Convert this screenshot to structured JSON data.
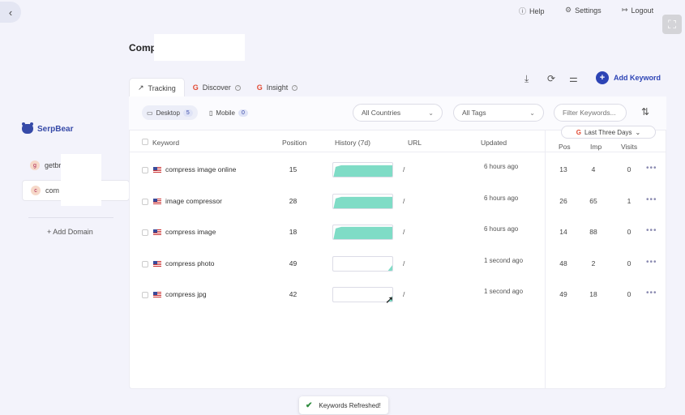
{
  "topnav": {
    "help": "Help",
    "settings": "Settings",
    "logout": "Logout"
  },
  "brand": {
    "name": "SerpBear"
  },
  "sidebar": {
    "domains": [
      {
        "avatar": "g",
        "label": "getbr"
      },
      {
        "avatar": "c",
        "label": "com"
      }
    ],
    "add_domain": "+ Add Domain"
  },
  "page_title": "Comp",
  "tabs": [
    {
      "label": "Tracking",
      "icon": "trend-icon"
    },
    {
      "label": "Discover",
      "icon": "google-icon"
    },
    {
      "label": "Insight",
      "icon": "google-icon"
    }
  ],
  "toolbar": {
    "add_keyword": "Add Keyword"
  },
  "filters": {
    "desktop": "Desktop",
    "desktop_count": "5",
    "mobile": "Mobile",
    "mobile_count": "0",
    "countries": "All Countries",
    "tags": "All Tags",
    "search_placeholder": "Filter Keywords..."
  },
  "table": {
    "headers": {
      "keyword": "Keyword",
      "position": "Position",
      "history": "History (7d)",
      "url": "URL",
      "updated": "Updated"
    },
    "gsc": {
      "range": "Last Three Days",
      "pos": "Pos",
      "imp": "Imp",
      "visits": "Visits"
    },
    "rows": [
      {
        "keyword": "compress image online",
        "position": "15",
        "url": "/",
        "updated": "6 hours ago",
        "pos": "13",
        "imp": "4",
        "visits": "0",
        "history_fill": 0.85
      },
      {
        "keyword": "image compressor",
        "position": "28",
        "url": "/",
        "updated": "6 hours ago",
        "pos": "26",
        "imp": "65",
        "visits": "1",
        "history_fill": 0.85
      },
      {
        "keyword": "compress image",
        "position": "18",
        "url": "/",
        "updated": "6 hours ago",
        "pos": "14",
        "imp": "88",
        "visits": "0",
        "history_fill": 0.9
      },
      {
        "keyword": "compress photo",
        "position": "49",
        "url": "/",
        "updated": "1 second ago",
        "pos": "48",
        "imp": "2",
        "visits": "0",
        "history_fill": 0.1
      },
      {
        "keyword": "compress jpg",
        "position": "42",
        "url": "/",
        "updated": "1 second ago",
        "pos": "49",
        "imp": "18",
        "visits": "0",
        "history_fill": 0.1
      }
    ]
  },
  "toast": {
    "message": "Keywords Refreshed!"
  },
  "colors": {
    "accent": "#2d44b5",
    "history_fill": "#7fdcc6"
  }
}
